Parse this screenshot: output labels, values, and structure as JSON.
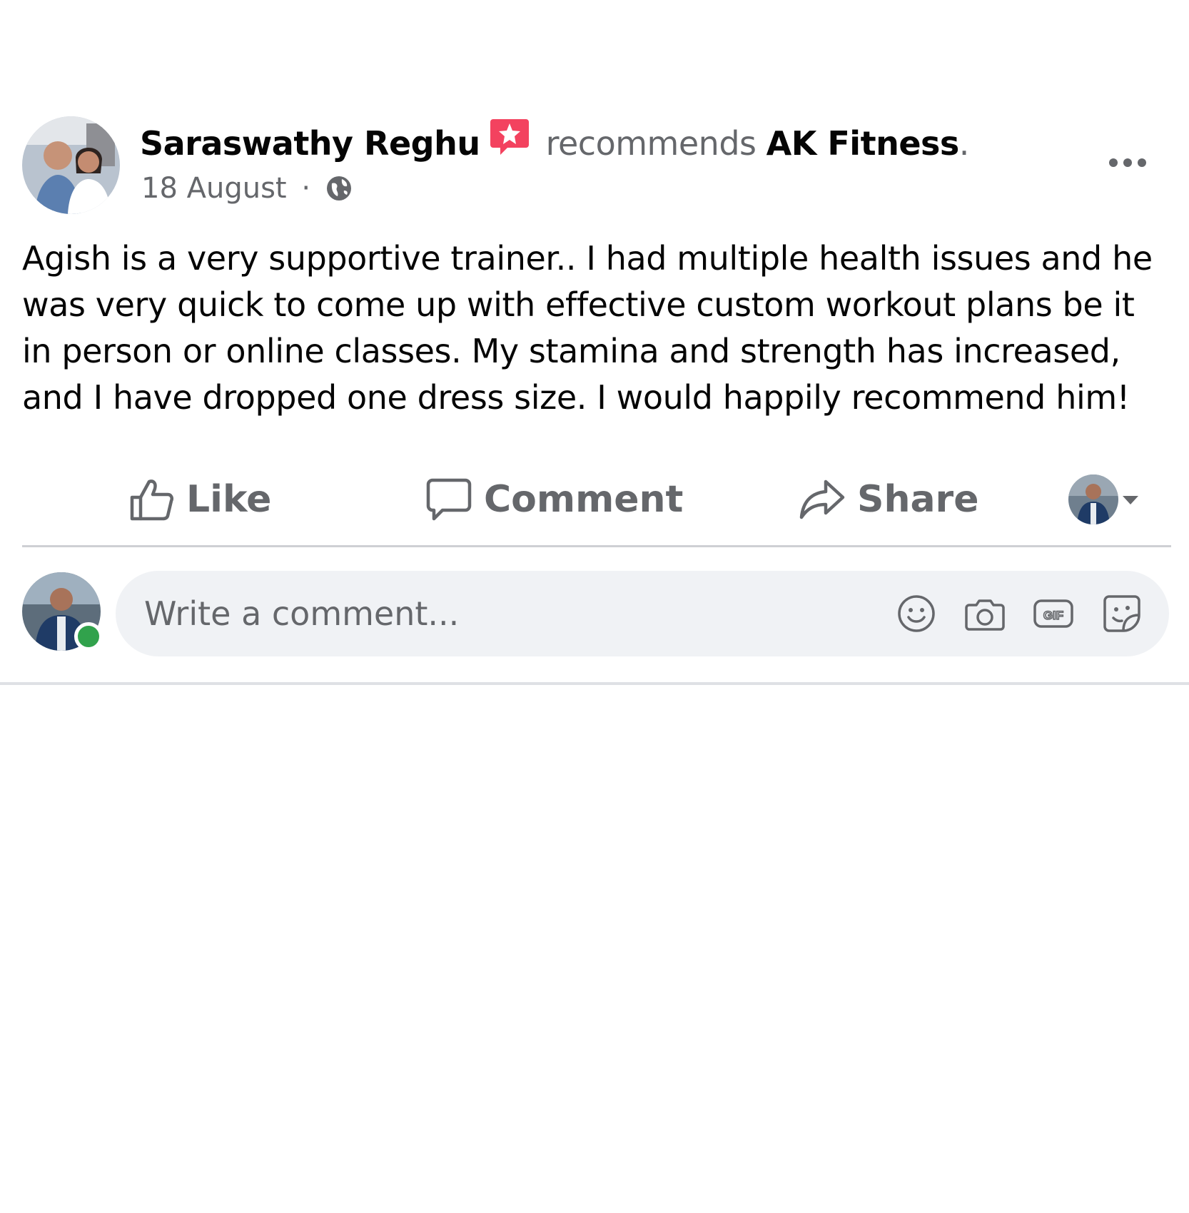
{
  "post": {
    "author": "Saraswathy Reghu",
    "verb": "recommends",
    "page_name": "AK Fitness",
    "page_suffix": ".",
    "date": "18 August",
    "separator": "·",
    "privacy_icon": "globe-icon",
    "body": "Agish is a very supportive trainer.. I had multiple health issues and he was very quick to come up with effective custom workout plans be it in person or online classes. My stamina and strength has increased, and I have dropped one dress size. I would happily recommend him!"
  },
  "actions": {
    "like": "Like",
    "comment": "Comment",
    "share": "Share"
  },
  "comment": {
    "placeholder": "Write a comment..."
  },
  "colors": {
    "text": "#050505",
    "secondary_text": "#65676b",
    "recommend_badge": "#f3425f",
    "online": "#31a24c",
    "input_bg": "#f0f2f5"
  }
}
